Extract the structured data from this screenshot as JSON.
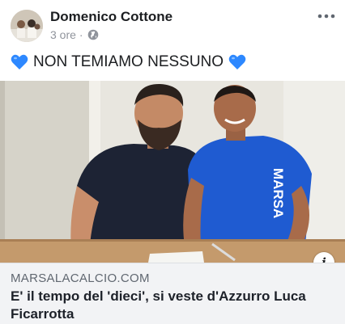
{
  "post": {
    "author": "Domenico Cottone",
    "time": "3 ore",
    "separator": "·",
    "message": "NON TEMIAMO NESSUNO"
  },
  "link": {
    "domain": "MARSALACALCIO.COM",
    "title": "E' il tempo del 'dieci', si veste d'Azzurro Luca Ficarrotta"
  },
  "photo": {
    "shirt_text": "MARSA"
  },
  "info_label": "i",
  "colors": {
    "heart": "#2d88ff",
    "jersey": "#1f5bd1",
    "polo": "#1d2334"
  },
  "icons": [
    "globe-icon",
    "more-icon",
    "blue-heart-icon",
    "info-icon"
  ]
}
